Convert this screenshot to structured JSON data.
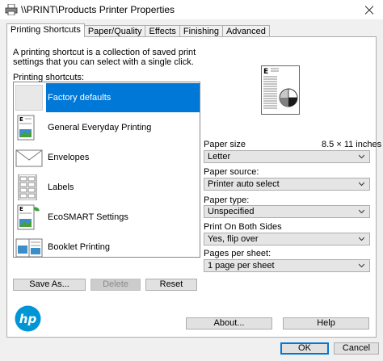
{
  "window": {
    "title": "\\\\PRINT\\Products Printer Properties"
  },
  "tabs": [
    {
      "label": "Printing Shortcuts",
      "active": true
    },
    {
      "label": "Paper/Quality",
      "active": false
    },
    {
      "label": "Effects",
      "active": false
    },
    {
      "label": "Finishing",
      "active": false
    },
    {
      "label": "Advanced",
      "active": false
    }
  ],
  "shortcuts_panel": {
    "description": "A printing shortcut is a collection of saved print settings that you can select with a single click.",
    "list_label": "Printing shortcuts:",
    "items": [
      {
        "label": "Factory defaults",
        "icon": "blank-page-icon",
        "selected": true
      },
      {
        "label": "General Everyday Printing",
        "icon": "document-image-icon",
        "selected": false
      },
      {
        "label": "Envelopes",
        "icon": "envelope-icon",
        "selected": false
      },
      {
        "label": "Labels",
        "icon": "labels-sheet-icon",
        "selected": false
      },
      {
        "label": "EcoSMART Settings",
        "icon": "eco-document-icon",
        "selected": false
      },
      {
        "label": "Booklet Printing",
        "icon": "booklet-icon",
        "selected": false
      }
    ],
    "save_as_label": "Save As...",
    "delete_label": "Delete",
    "reset_label": "Reset"
  },
  "settings": {
    "paper_size_label": "Paper size",
    "paper_size_dims": "8.5 × 11 inches",
    "paper_size_value": "Letter",
    "paper_source_label": "Paper source:",
    "paper_source_value": "Printer auto select",
    "paper_type_label": "Paper type:",
    "paper_type_value": "Unspecified",
    "duplex_label": "Print On Both Sides",
    "duplex_value": "Yes, flip over",
    "pages_per_sheet_label": "Pages per sheet:",
    "pages_per_sheet_value": "1 page per sheet"
  },
  "brand": {
    "logo": "hp-logo",
    "color": "#0096d6"
  },
  "footer": {
    "about_label": "About...",
    "help_label": "Help",
    "ok_label": "OK",
    "cancel_label": "Cancel"
  },
  "colors": {
    "selection": "#0078d7",
    "panel_bg": "#ffffff",
    "window_bg": "#f0f0f0"
  }
}
